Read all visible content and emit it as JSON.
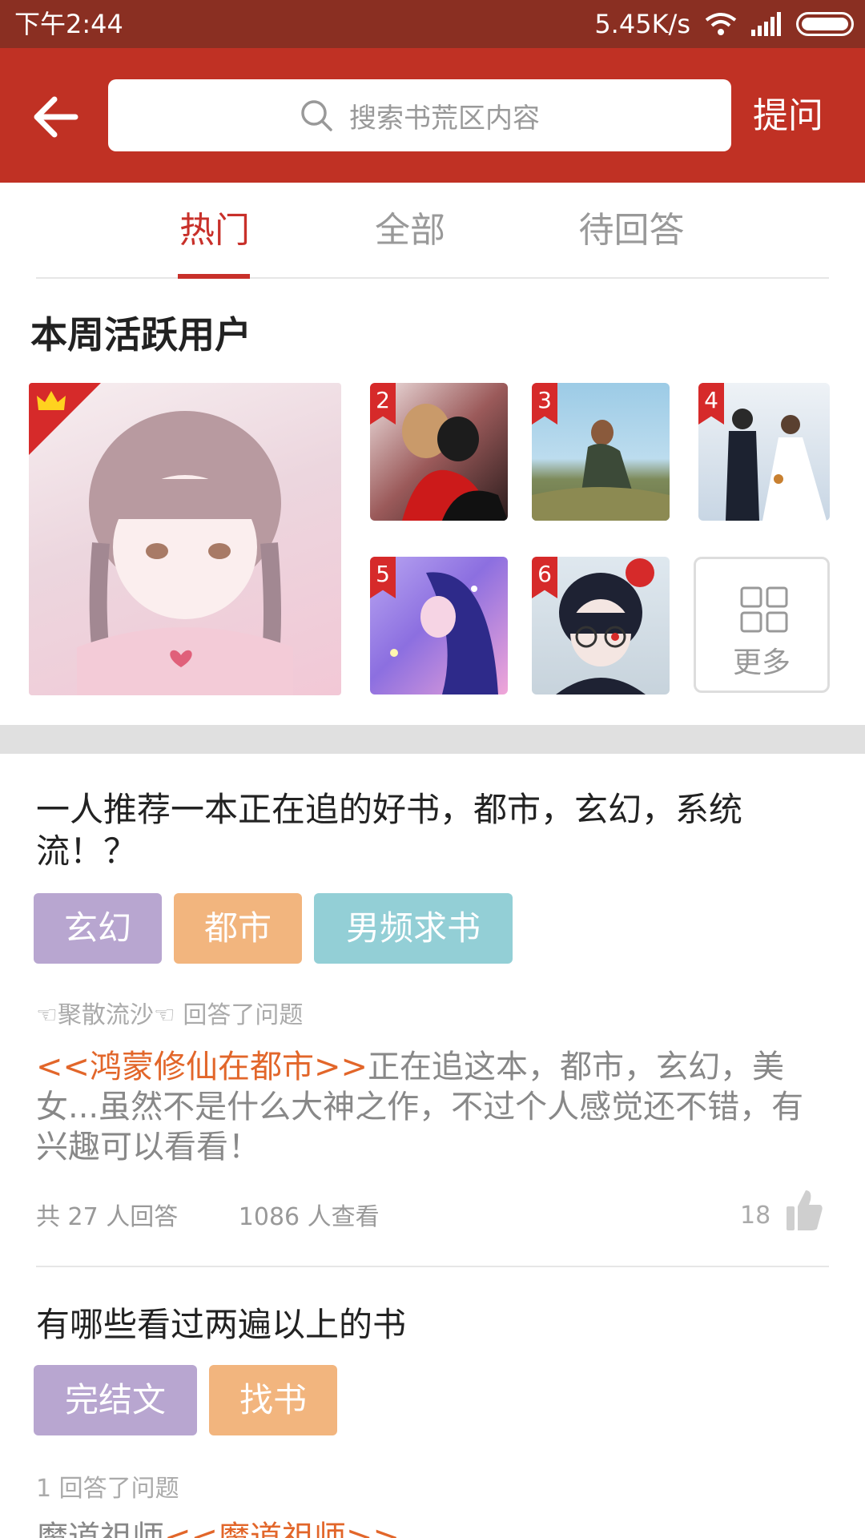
{
  "status_bar": {
    "time": "下午2:44",
    "speed": "5.45K/s"
  },
  "header": {
    "search_placeholder": "搜索书荒区内容",
    "ask_label": "提问"
  },
  "tabs": [
    {
      "label": "热门",
      "active": true
    },
    {
      "label": "全部",
      "active": false
    },
    {
      "label": "待回答",
      "active": false
    }
  ],
  "active_users": {
    "title": "本周活跃用户",
    "ranks": [
      "2",
      "3",
      "4",
      "5",
      "6"
    ],
    "more_label": "更多"
  },
  "questions": [
    {
      "title": "一人推荐一本正在追的好书，都市，玄幻，系统流！？",
      "tags": [
        "玄幻",
        "都市",
        "男频求书"
      ],
      "answerer": "☜聚散流沙☜ 回答了问题",
      "book": "<<鸿蒙修仙在都市>>",
      "answer": "正在追这本，都市，玄幻，美女...虽然不是什么大神之作，不过个人感觉还不错，有兴趣可以看看！",
      "answer_count": "共 27 人回答",
      "view_count": "1086 人查看",
      "likes": "18"
    },
    {
      "title": "有哪些看过两遍以上的书",
      "tags": [
        "完结文",
        "找书"
      ],
      "answerer": "1 回答了问题",
      "answer_prefix": "魔道祖师",
      "book": "<<魔道祖师>>"
    }
  ],
  "colors": {
    "header": "#c03124",
    "status_bar": "#8a2f22",
    "accent": "#c8302a",
    "tag_purple": "#b8a6d0",
    "tag_orange": "#f2b57e",
    "tag_teal": "#93cfd6",
    "book_link": "#e2662a"
  }
}
